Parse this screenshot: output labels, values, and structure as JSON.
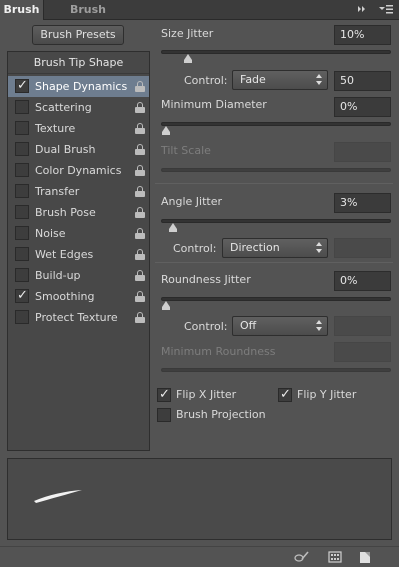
{
  "tabs": {
    "brush": "Brush",
    "brush_presets": "Brush Presets",
    "menu_icons": [
      "double-chevron-right-icon",
      "panel-menu-icon"
    ]
  },
  "sidebar": {
    "presets_button": "Brush Presets",
    "tip_shape": "Brush Tip Shape",
    "items": [
      {
        "label": "Shape Dynamics",
        "checked": true,
        "selected": true
      },
      {
        "label": "Scattering",
        "checked": false,
        "selected": false
      },
      {
        "label": "Texture",
        "checked": false,
        "selected": false
      },
      {
        "label": "Dual Brush",
        "checked": false,
        "selected": false
      },
      {
        "label": "Color Dynamics",
        "checked": false,
        "selected": false
      },
      {
        "label": "Transfer",
        "checked": false,
        "selected": false
      },
      {
        "label": "Brush Pose",
        "checked": false,
        "selected": false
      },
      {
        "label": "Noise",
        "checked": false,
        "selected": false
      },
      {
        "label": "Wet Edges",
        "checked": false,
        "selected": false
      },
      {
        "label": "Build-up",
        "checked": false,
        "selected": false
      },
      {
        "label": "Smoothing",
        "checked": true,
        "selected": false
      },
      {
        "label": "Protect Texture",
        "checked": false,
        "selected": false
      }
    ]
  },
  "settings": {
    "size_jitter": {
      "label": "Size Jitter",
      "value": "10%",
      "slider_pct": 10
    },
    "size_control": {
      "label": "Control:",
      "option": "Fade",
      "value": "50"
    },
    "min_diameter": {
      "label": "Minimum Diameter",
      "value": "0%",
      "slider_pct": 0
    },
    "tilt_scale": {
      "label": "Tilt Scale",
      "value": ""
    },
    "angle_jitter": {
      "label": "Angle Jitter",
      "value": "3%",
      "slider_pct": 3
    },
    "angle_control": {
      "label": "Control:",
      "option": "Direction",
      "value": ""
    },
    "roundness_jitter": {
      "label": "Roundness Jitter",
      "value": "0%",
      "slider_pct": 0
    },
    "roundness_control": {
      "label": "Control:",
      "option": "Off",
      "value": ""
    },
    "min_roundness": {
      "label": "Minimum Roundness",
      "value": ""
    },
    "flip_x": {
      "label": "Flip X Jitter",
      "checked": true
    },
    "flip_y": {
      "label": "Flip Y Jitter",
      "checked": true
    },
    "brush_projection": {
      "label": "Brush Projection",
      "checked": false
    }
  },
  "bottom_icons": [
    "toggle-live-tip-icon",
    "brush-grid-icon",
    "new-preset-icon"
  ],
  "colors": {
    "panel": "#535353",
    "selected": "#6e7d8f",
    "field": "#3b3b3b"
  }
}
